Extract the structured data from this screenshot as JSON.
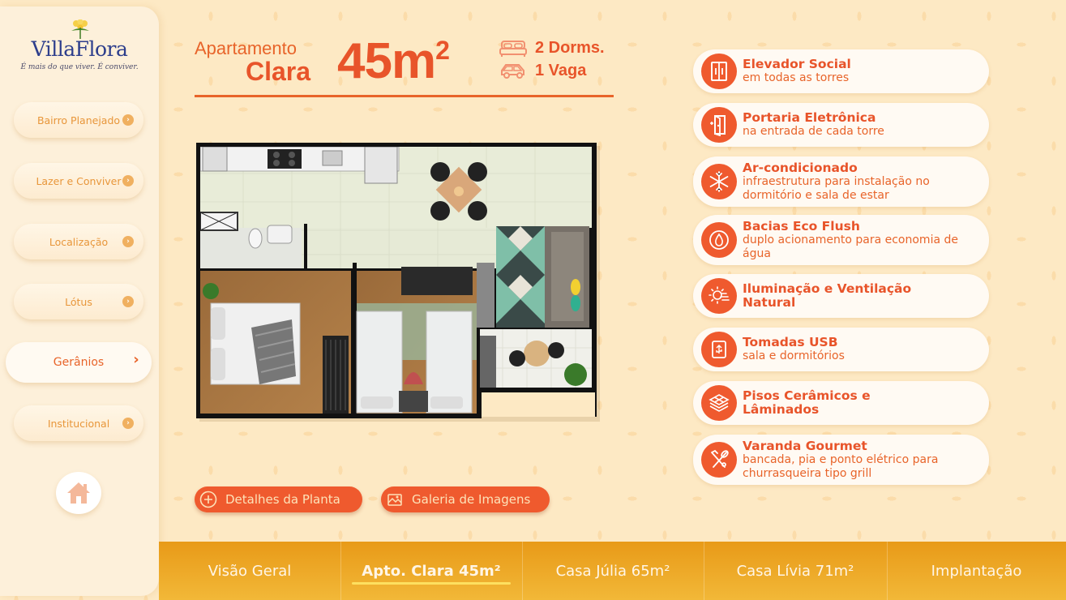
{
  "brand": {
    "name": "VillaFlora",
    "tagline": "É mais do que viver. É conviver."
  },
  "sidebar": {
    "items": [
      {
        "label": "Bairro Planejado"
      },
      {
        "label": "Lazer e Conviver"
      },
      {
        "label": "Localização"
      },
      {
        "label": "Lótus"
      },
      {
        "label": "Gerânios",
        "active": true
      },
      {
        "label": "Institucional"
      }
    ],
    "home_icon": "home-icon"
  },
  "header": {
    "subtitle": "Apartamento",
    "name": "Clara",
    "area": "45m",
    "area_sup": "2",
    "dorms": "2 Dorms.",
    "vaga": "1 Vaga"
  },
  "actions": {
    "details": "Detalhes da Planta",
    "gallery": "Galeria de Imagens"
  },
  "features": [
    {
      "title": "Elevador Social",
      "desc": "em todas as torres",
      "icon": "elevator-icon"
    },
    {
      "title": "Portaria Eletrônica",
      "desc": "na entrada de cada torre",
      "icon": "door-icon"
    },
    {
      "title": "Ar-condicionado",
      "desc": "infraestrutura para instalação no dormitório e sala de estar",
      "icon": "snowflake-icon"
    },
    {
      "title": "Bacias Eco Flush",
      "desc": "duplo acionamento para economia de água",
      "icon": "water-drop-icon"
    },
    {
      "title": "Iluminação e Ventilação Natural",
      "desc": "",
      "icon": "sun-wind-icon"
    },
    {
      "title": "Tomadas USB",
      "desc": "sala e dormitórios",
      "icon": "usb-icon"
    },
    {
      "title": "Pisos Cerâmicos e Lâminados",
      "desc": "",
      "icon": "tiles-icon"
    },
    {
      "title": "Varanda Gourmet",
      "desc": "bancada, pia e ponto elétrico para churrasqueira tipo grill",
      "icon": "utensils-icon"
    }
  ],
  "tabs": [
    {
      "label": "Visão Geral"
    },
    {
      "label": "Apto. Clara 45m²",
      "active": true
    },
    {
      "label": "Casa Júlia 65m²"
    },
    {
      "label": "Casa Lívia 71m²"
    },
    {
      "label": "Implantação"
    }
  ],
  "colors": {
    "accent": "#ef5a2e",
    "background": "#fde9c4",
    "bar": "#e89a18"
  }
}
